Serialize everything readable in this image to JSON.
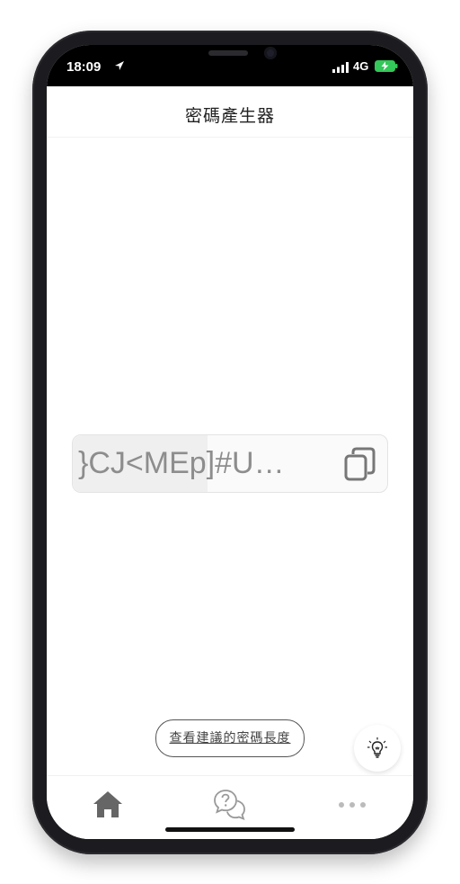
{
  "status_bar": {
    "time": "18:09",
    "network": "4G",
    "icons": [
      "location-arrow-icon",
      "signal-icon",
      "battery-charging-icon"
    ]
  },
  "header": {
    "title": "密碼產生器"
  },
  "password": {
    "value": "}CJ<MEp]#U…",
    "copy_icon": "copy-icon"
  },
  "suggest_button": {
    "label": "查看建議的密碼長度"
  },
  "floating_button": {
    "icon": "lightbulb-icon"
  },
  "tab_bar": {
    "tabs": [
      {
        "icon": "home-icon",
        "active": true
      },
      {
        "icon": "help-chat-icon",
        "active": false
      },
      {
        "icon": "more-icon",
        "active": false
      }
    ]
  },
  "colors": {
    "frame": "#1c1c20",
    "battery_green": "#34c759",
    "text_primary": "#222222",
    "text_muted": "#8d8d8d"
  }
}
